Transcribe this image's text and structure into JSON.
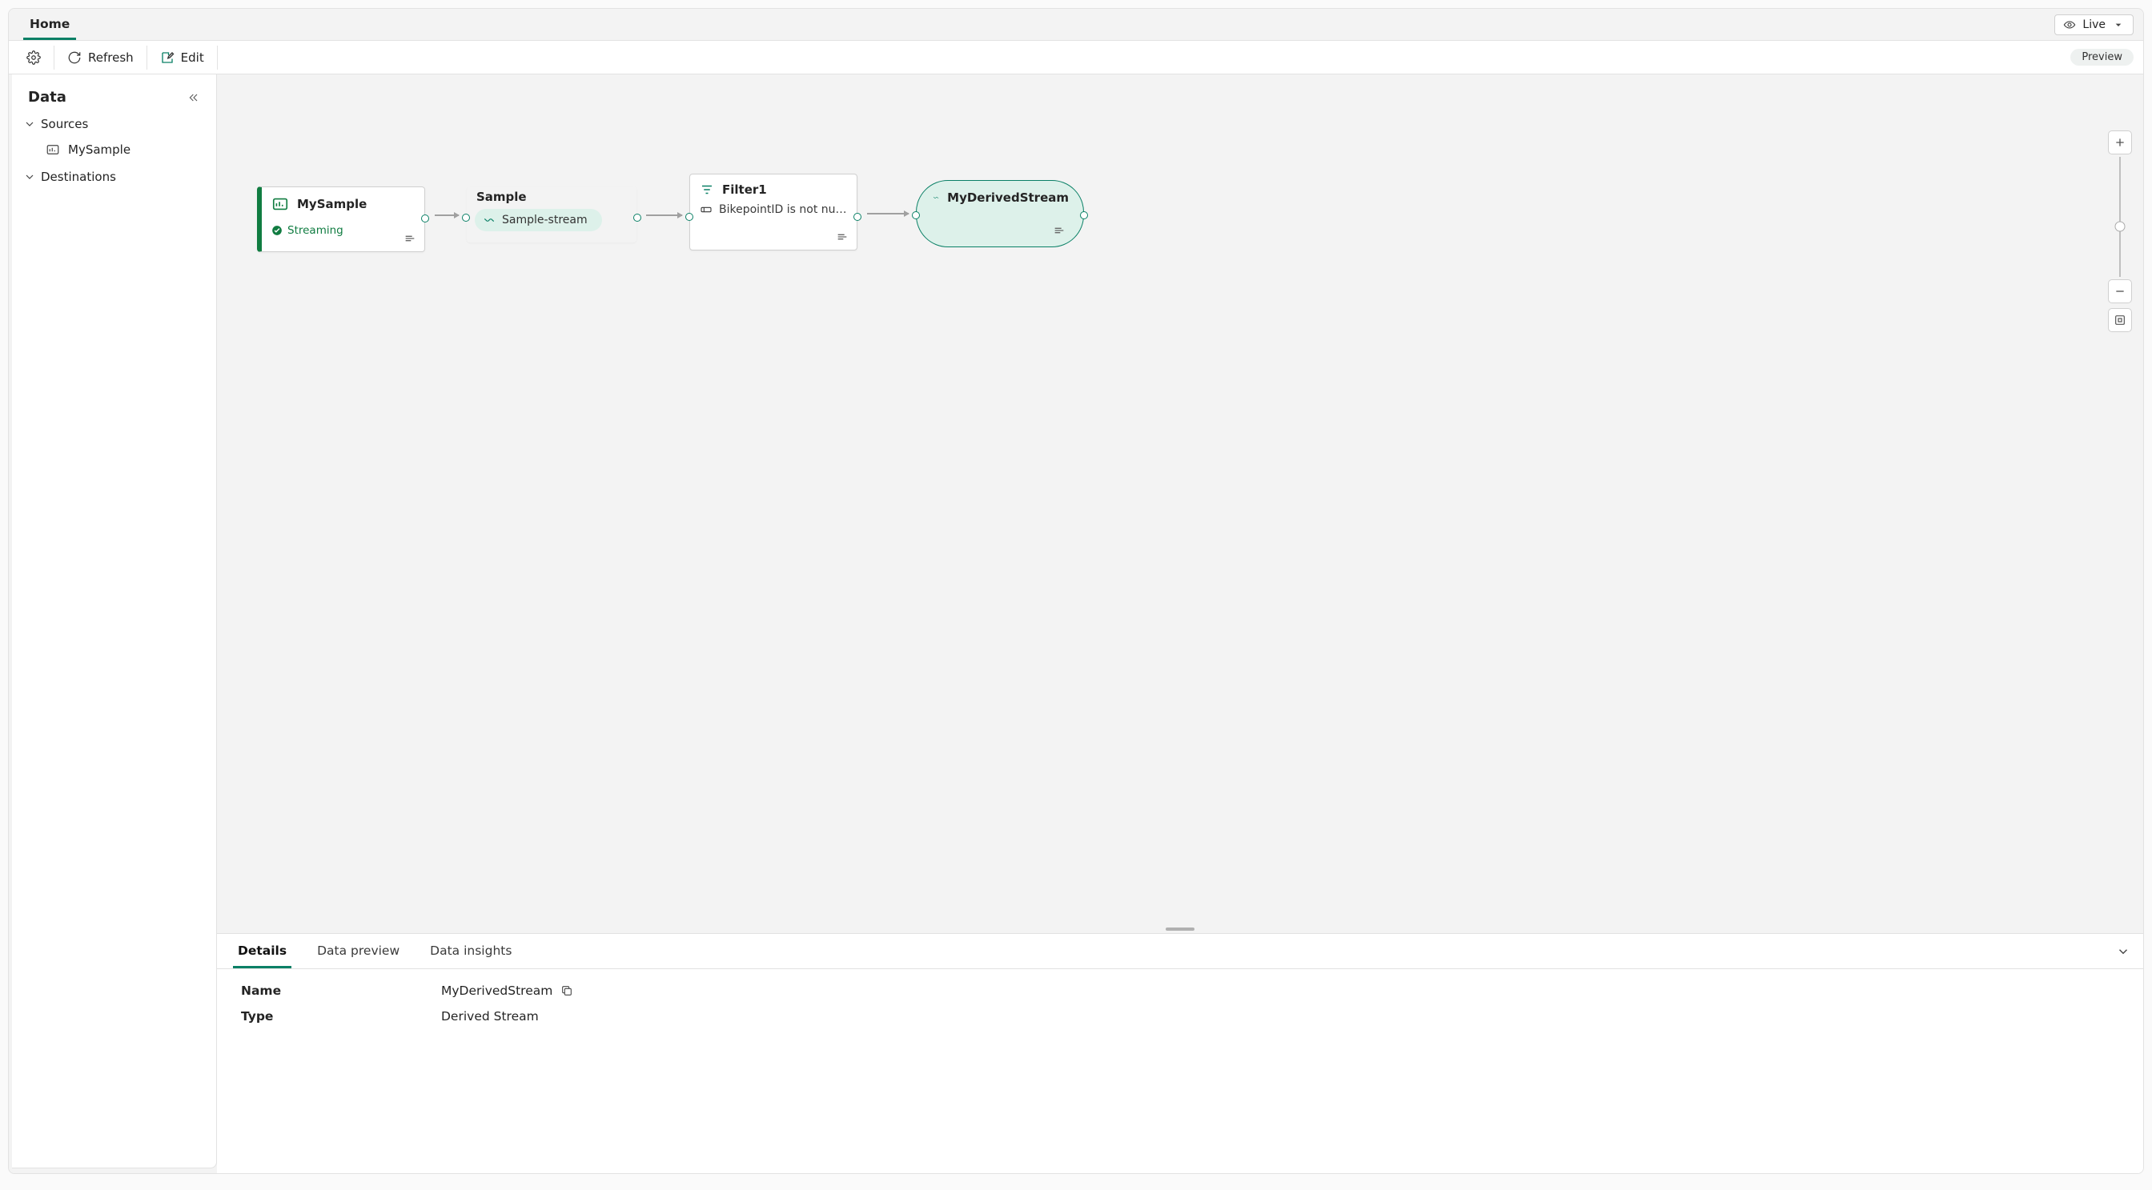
{
  "tabs": {
    "home": "Home"
  },
  "toolbar": {
    "refresh": "Refresh",
    "edit": "Edit",
    "live": "Live",
    "preview": "Preview"
  },
  "sidebar": {
    "title": "Data",
    "sources_label": "Sources",
    "destinations_label": "Destinations",
    "items": {
      "mysample": "MySample"
    }
  },
  "nodes": {
    "source": {
      "title": "MySample",
      "status": "Streaming"
    },
    "sample": {
      "title": "Sample",
      "chip": "Sample-stream"
    },
    "filter": {
      "title": "Filter1",
      "cond": "BikepointID is not null or e..."
    },
    "derived": {
      "title": "MyDerivedStream"
    }
  },
  "bottom": {
    "tabs": {
      "details": "Details",
      "preview": "Data preview",
      "insights": "Data insights"
    },
    "fields": {
      "name_label": "Name",
      "name_value": "MyDerivedStream",
      "type_label": "Type",
      "type_value": "Derived Stream"
    }
  }
}
